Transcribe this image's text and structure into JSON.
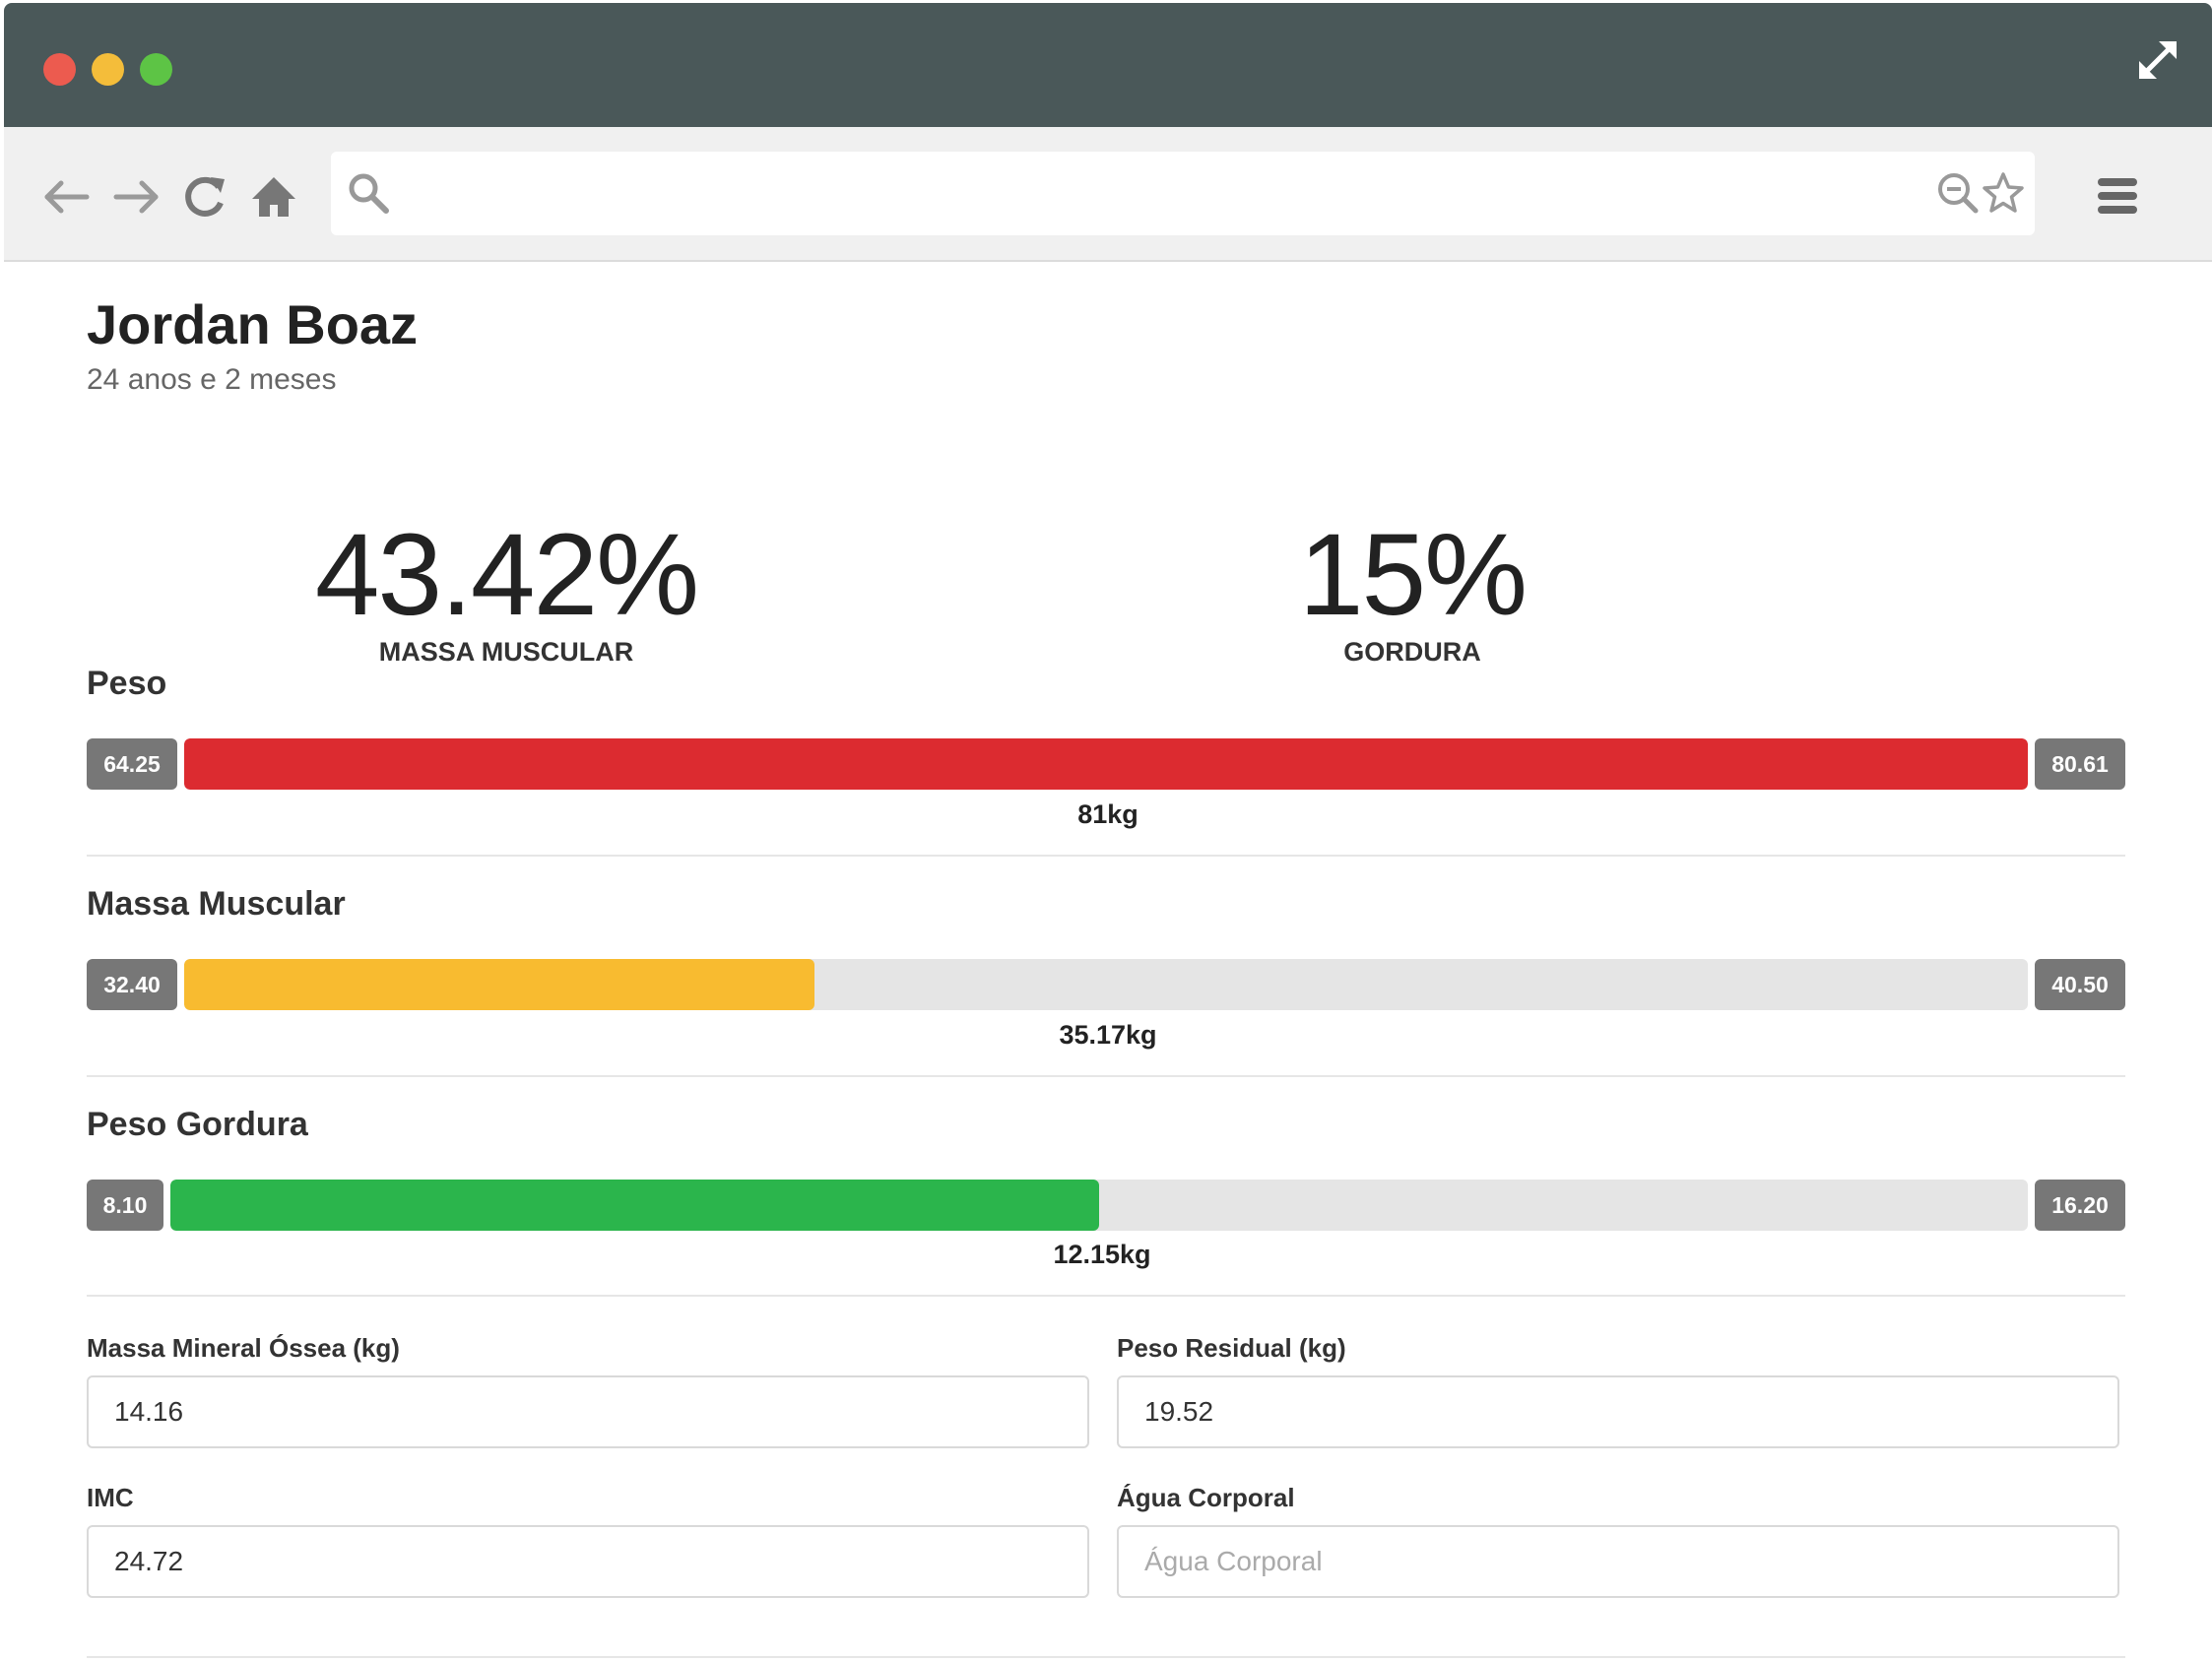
{
  "browser": {
    "url": ""
  },
  "profile": {
    "name": "Jordan Boaz",
    "age": "24 anos e 2 meses"
  },
  "stats": {
    "muscle": {
      "value": "43.42%",
      "label": "MASSA MUSCULAR"
    },
    "fat": {
      "value": "15%",
      "label": "GORDURA"
    }
  },
  "bars": {
    "peso": {
      "title": "Peso",
      "min": "64.25",
      "max": "80.61",
      "value": "81kg",
      "fraction": 1.0,
      "color": "#dc2b30"
    },
    "massa": {
      "title": "Massa Muscular",
      "min": "32.40",
      "max": "40.50",
      "value": "35.17kg",
      "fraction": 0.342,
      "color": "#f8bb30"
    },
    "gordura": {
      "title": "Peso Gordura",
      "min": "8.10",
      "max": "16.20",
      "value": "12.15kg",
      "fraction": 0.5,
      "color": "#2bb54c"
    }
  },
  "fields": {
    "massa_mineral": {
      "label": "Massa Mineral Óssea (kg)",
      "value": "14.16",
      "placeholder": ""
    },
    "peso_residual": {
      "label": "Peso Residual (kg)",
      "value": "19.52",
      "placeholder": ""
    },
    "imc": {
      "label": "IMC",
      "value": "24.72",
      "placeholder": ""
    },
    "agua": {
      "label": "Água Corporal",
      "value": "",
      "placeholder": "Água Corporal"
    }
  },
  "icons": {
    "back": "arrow-left-icon",
    "forward": "arrow-right-icon",
    "reload": "reload-icon",
    "home": "home-icon",
    "search": "search-icon",
    "zoom": "zoom-out-icon",
    "bookmark": "star-icon",
    "menu": "hamburger-menu-icon",
    "expand": "expand-icon"
  }
}
